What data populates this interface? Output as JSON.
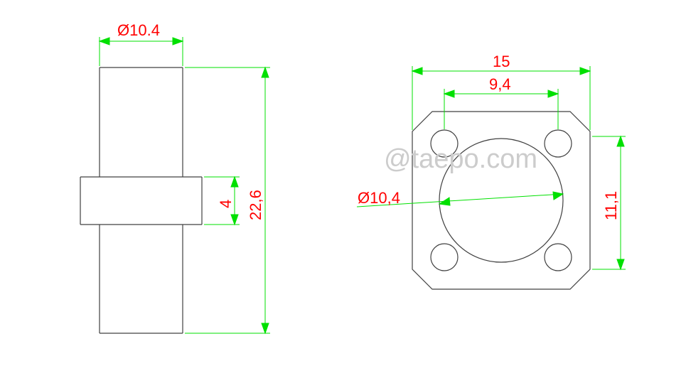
{
  "dimension_stroke": "#00e000",
  "part_stroke": "#404040",
  "dim_text_color": "#ff0000",
  "watermark_color": "#cccccc",
  "left_view": {
    "top_dia_label": "Ø10.4",
    "right_height_label": "22,6",
    "flange_height_label": "4"
  },
  "right_view": {
    "outer_width_label": "15",
    "inner_width_label": "9,4",
    "center_dia_label": "Ø10,4",
    "right_height_label": "11,1"
  },
  "watermark": "@taepo.com"
}
